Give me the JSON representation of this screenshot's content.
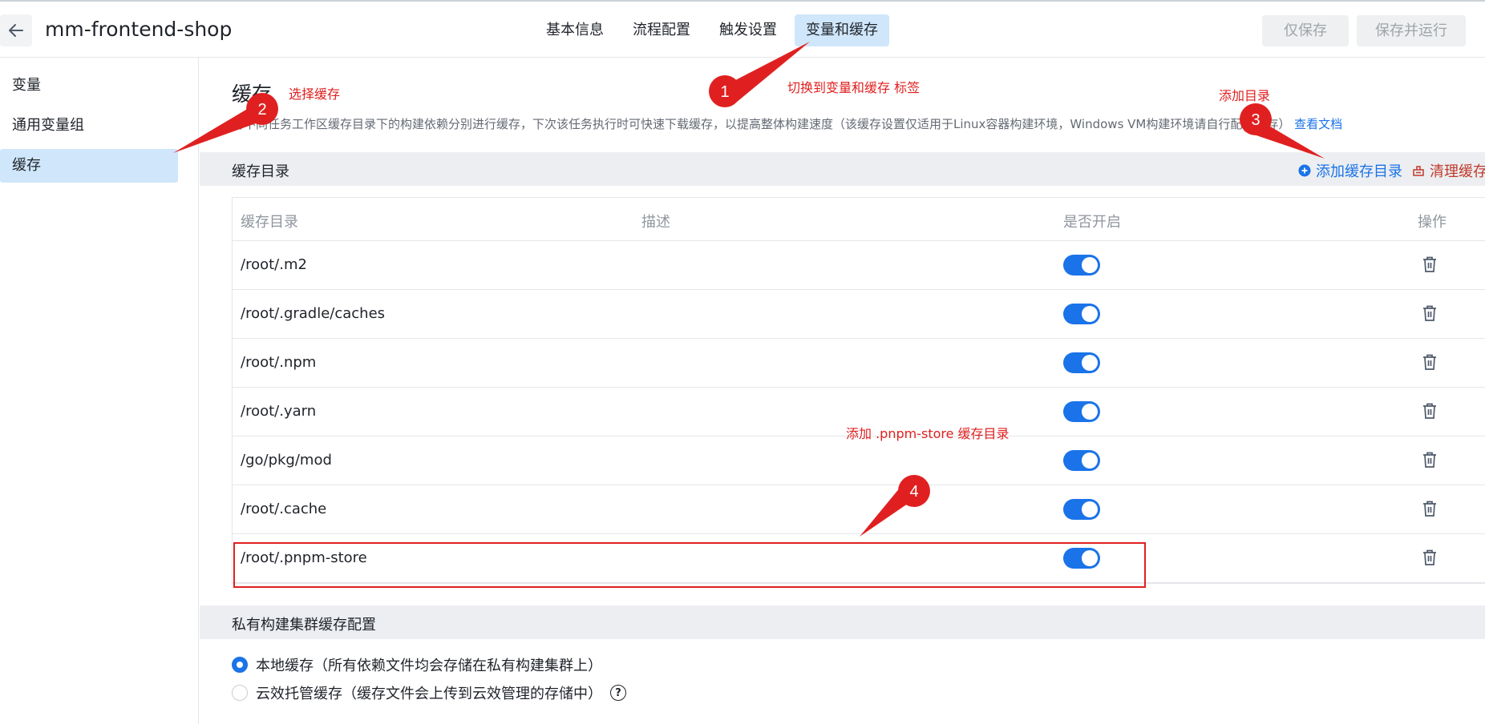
{
  "header": {
    "app_title": "mm-frontend-shop",
    "tabs": [
      {
        "label": "基本信息",
        "active": false
      },
      {
        "label": "流程配置",
        "active": false
      },
      {
        "label": "触发设置",
        "active": false
      },
      {
        "label": "变量和缓存",
        "active": true
      }
    ],
    "save_only_label": "仅保存",
    "save_run_label": "保存并运行"
  },
  "sidebar": {
    "items": [
      {
        "label": "变量",
        "active": false
      },
      {
        "label": "通用变量组",
        "active": false
      },
      {
        "label": "缓存",
        "active": true
      }
    ]
  },
  "main": {
    "title": "缓存",
    "description": "将不同任务工作区缓存目录下的构建依赖分别进行缓存，下次该任务执行时可快速下载缓存，以提高整体构建速度（该缓存设置仅适用于Linux容器构建环境，Windows VM构建环境请自行配置缓存）",
    "doc_link": "查看文档",
    "cache_section": {
      "title": "缓存目录",
      "add_label": "添加缓存目录",
      "clear_label": "清理缓存"
    },
    "table": {
      "columns": [
        "缓存目录",
        "描述",
        "是否开启",
        "操作"
      ],
      "rows": [
        {
          "path": "/root/.m2",
          "description": "",
          "enabled": true
        },
        {
          "path": "/root/.gradle/caches",
          "description": "",
          "enabled": true
        },
        {
          "path": "/root/.npm",
          "description": "",
          "enabled": true
        },
        {
          "path": "/root/.yarn",
          "description": "",
          "enabled": true
        },
        {
          "path": "/go/pkg/mod",
          "description": "",
          "enabled": true
        },
        {
          "path": "/root/.cache",
          "description": "",
          "enabled": true
        },
        {
          "path": "/root/.pnpm-store",
          "description": "",
          "enabled": true
        }
      ]
    },
    "private_section": {
      "title": "私有构建集群缓存配置",
      "options": [
        {
          "label": "本地缓存（所有依赖文件均会存储在私有构建集群上）",
          "checked": true
        },
        {
          "label": "云效托管缓存（缓存文件会上传到云效管理的存储中）",
          "checked": false
        }
      ],
      "help_glyph": "?"
    }
  },
  "annotations": {
    "step1": {
      "number": "1",
      "text": "切换到变量和缓存 标签"
    },
    "step2": {
      "number": "2",
      "text": "选择缓存"
    },
    "step3": {
      "number": "3",
      "text": "添加目录"
    },
    "step4": {
      "number": "4",
      "text": "添加 .pnpm-store 缓存目录"
    }
  },
  "colors": {
    "accent": "#1a73e8",
    "active_bg": "#cfe6fb",
    "annotation": "#e02020",
    "danger": "#c0392b"
  }
}
